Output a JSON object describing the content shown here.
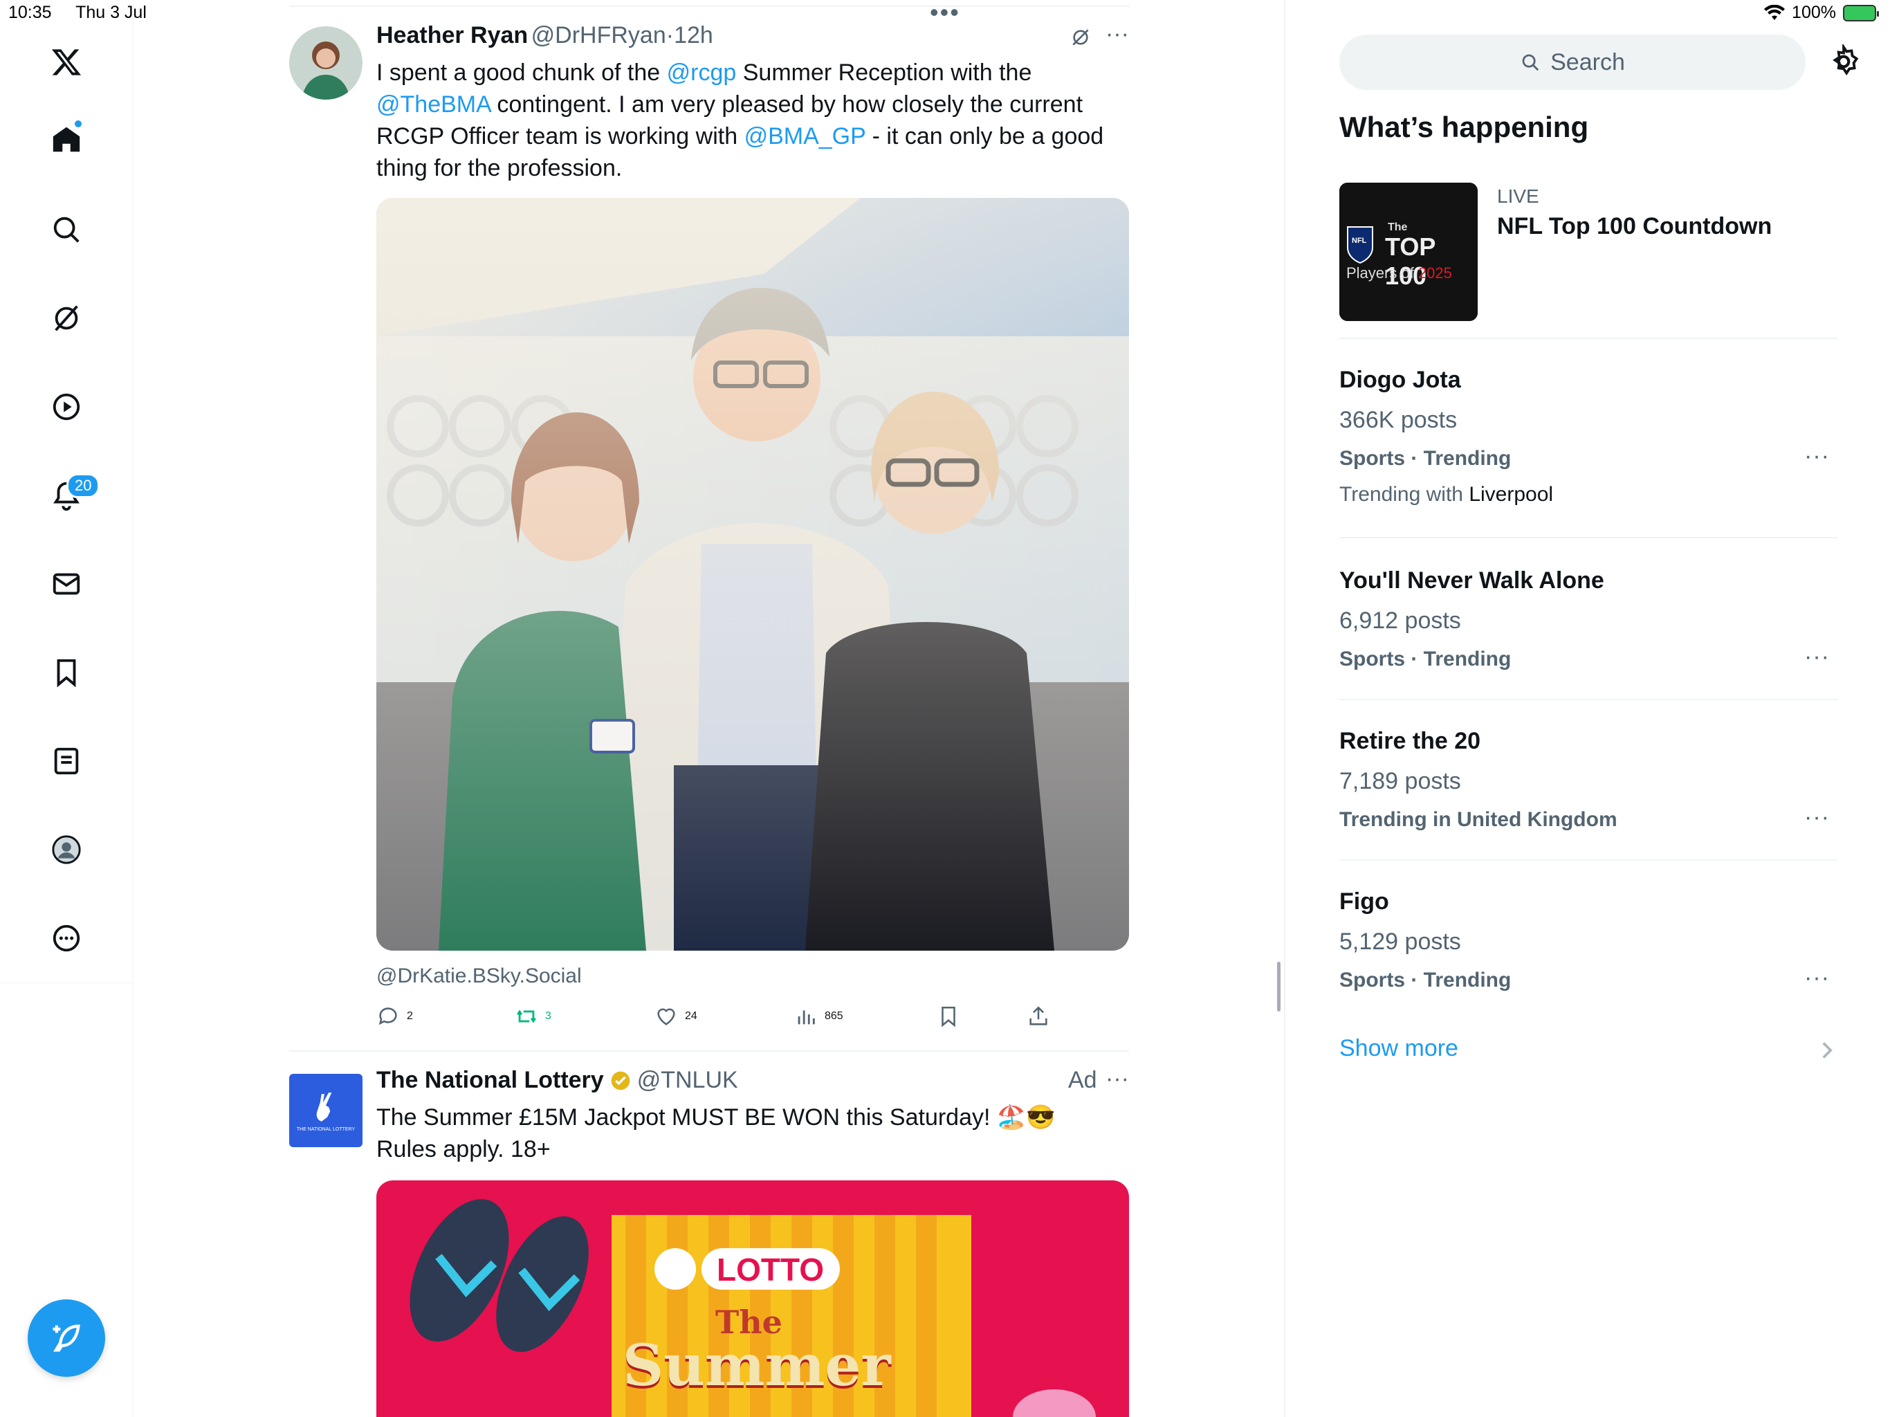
{
  "status_bar": {
    "time": "10:35",
    "date": "Thu 3 Jul",
    "battery": "100%"
  },
  "nav": {
    "notifications_count": "20",
    "items": [
      "home",
      "explore",
      "grok",
      "video",
      "notifications",
      "messages",
      "bookmarks",
      "lists",
      "profile",
      "more"
    ]
  },
  "tweet1": {
    "name": "Heather Ryan",
    "handle": "@DrHFRyan",
    "dot": "·",
    "time": "12h",
    "text_1": "I spent a good chunk of the ",
    "mention_1": "@rcgp",
    "text_2": " Summer Reception with the ",
    "mention_2": "@TheBMA",
    "text_3": " contingent. I am very pleased by how closely the current RCGP Officer team is working with ",
    "mention_3": "@BMA_GP",
    "text_4": " - it can only be a good thing for the profession.",
    "photo_credit": "@DrKatie.BSky.Social",
    "replies": "2",
    "reposts": "3",
    "likes": "24",
    "views": "865"
  },
  "tweet2": {
    "name": "The National Lottery",
    "handle": "@TNLUK",
    "ad_label": "Ad",
    "text_line1": "The Summer £15M Jackpot MUST BE WON this Saturday! 🏖️😎",
    "text_line2": "Rules apply. 18+",
    "banner_brand": "LOTTO",
    "banner_the": "The",
    "banner_summer": "Summer",
    "avatar_text": "THE NATIONAL LOTTERY"
  },
  "sidebar": {
    "search_placeholder": "Search",
    "heading": "What’s happening",
    "live": {
      "label": "LIVE",
      "title": "NFL Top 100 Countdown",
      "thumb_line1": "The",
      "thumb_line2": "TOP 100",
      "thumb_line3a": "Players of ",
      "thumb_line3b": "2025",
      "thumb_badge": "NFL"
    },
    "trends": [
      {
        "title": "Diogo Jota",
        "count": "366K posts",
        "category": "Sports · Trending",
        "with_label": "Trending with ",
        "with_value": "Liverpool"
      },
      {
        "title": "You'll Never Walk Alone",
        "count": "6,912 posts",
        "category": "Sports · Trending"
      },
      {
        "title": "Retire the 20",
        "count": "7,189 posts",
        "category": "Trending in United Kingdom"
      },
      {
        "title": "Figo",
        "count": "5,129 posts",
        "category": "Sports · Trending"
      }
    ],
    "show_more": "Show more"
  },
  "colors": {
    "accent": "#1d9bf0",
    "repost_green": "#00ba7c",
    "text_secondary": "#536471"
  }
}
